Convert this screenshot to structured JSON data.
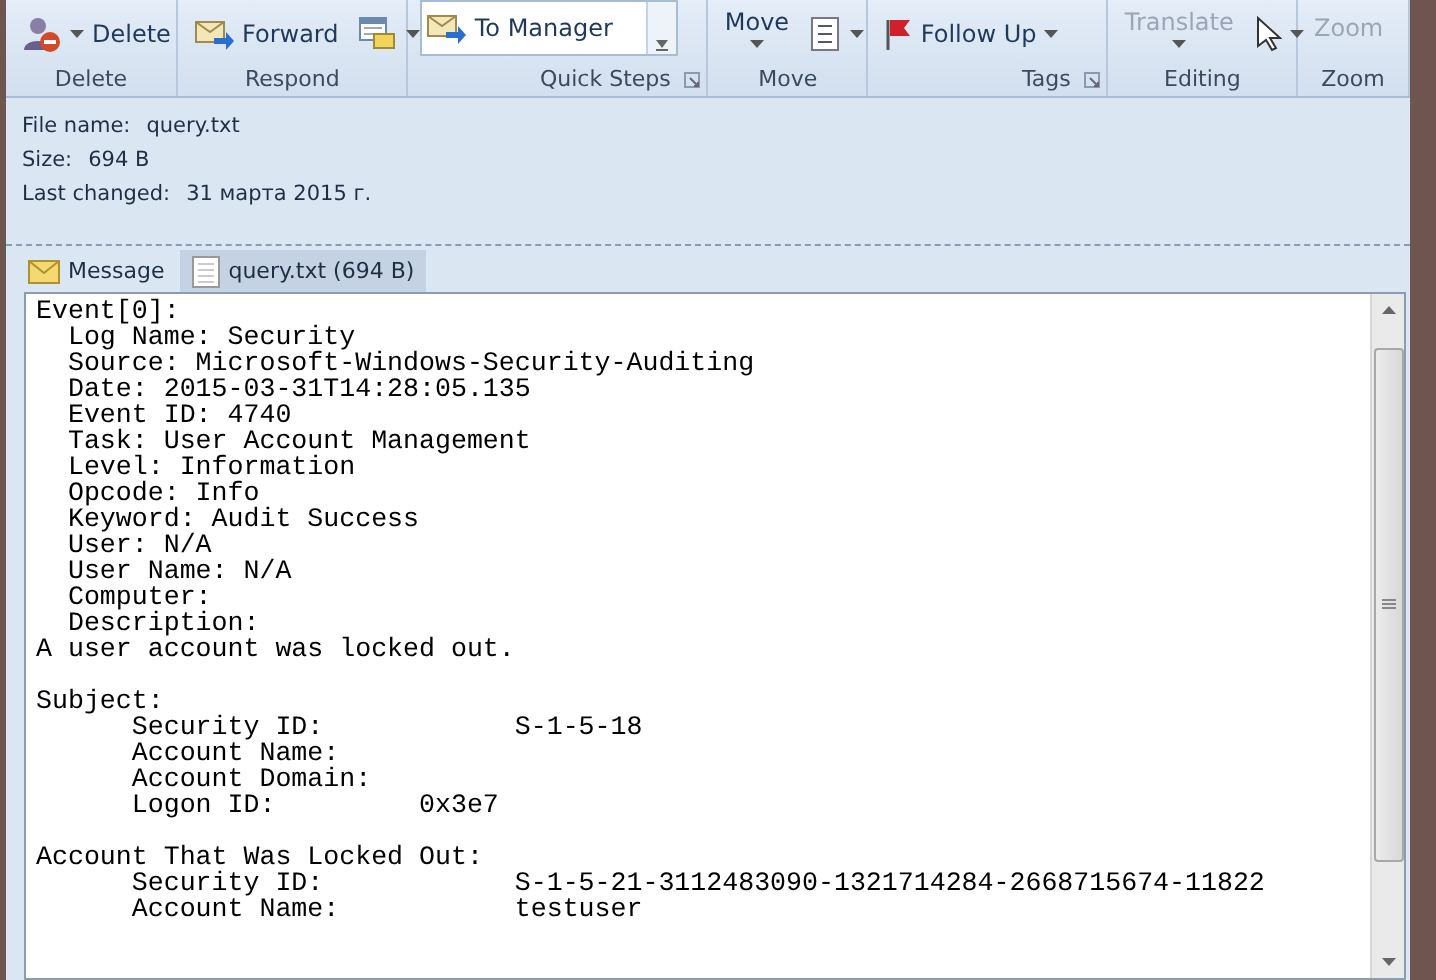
{
  "ribbon": {
    "groups": [
      {
        "label": "Delete",
        "items": [
          {
            "kind": "big",
            "label": "Delete",
            "caret": true
          }
        ]
      },
      {
        "label": "Respond",
        "items": [
          {
            "kind": "small",
            "label": "Forward",
            "caret": false
          },
          {
            "kind": "iconbtn",
            "caret": true
          }
        ]
      },
      {
        "label": "Quick Steps",
        "launcher": true,
        "items": [
          {
            "kind": "quickstep",
            "label": "To Manager"
          }
        ]
      },
      {
        "label": "Move",
        "items": [
          {
            "kind": "tall",
            "label": "Move",
            "caret": true,
            "disabled": false
          },
          {
            "kind": "iconbtn",
            "caret": true
          }
        ]
      },
      {
        "label": "Tags",
        "launcher": true,
        "items": [
          {
            "kind": "small",
            "label": "Follow Up",
            "caret": true
          }
        ]
      },
      {
        "label": "Editing",
        "items": [
          {
            "kind": "tall",
            "label": "Translate",
            "caret": true,
            "disabled": true
          },
          {
            "kind": "iconbtn",
            "caret": true
          }
        ]
      },
      {
        "label": "Zoom",
        "items": [
          {
            "kind": "tall",
            "label": "Zoom",
            "caret": false,
            "disabled": true
          }
        ]
      }
    ]
  },
  "attachment": {
    "fields": [
      {
        "label": "File name:",
        "value": "query.txt"
      },
      {
        "label": "Size:",
        "value": "694 B"
      },
      {
        "label": "Last changed:",
        "value": "31 марта 2015 г."
      }
    ]
  },
  "tabs": [
    {
      "label": "Message",
      "selected": false
    },
    {
      "label": "query.txt (694 B)",
      "selected": true
    }
  ],
  "preview": {
    "blocks": [
      [
        "Event[0]:",
        "  Log Name: Security",
        "  Source: Microsoft-Windows-Security-Auditing",
        "  Date: 2015-03-31T14:28:05.135",
        "  Event ID: 4740",
        "  Task: User Account Management",
        "  Level: Information",
        "  Opcode: Info",
        "  Keyword: Audit Success",
        "  User: N/A",
        "  User Name: N/A",
        "  Computer:",
        "  Description:",
        "A user account was locked out."
      ],
      [
        "Subject:",
        "      Security ID:            S-1-5-18",
        "      Account Name:",
        "      Account Domain:",
        "      Logon ID:         0x3e7"
      ],
      [
        "Account That Was Locked Out:",
        "      Security ID:            S-1-5-21-3112483090-1321714284-2668715674-11822",
        "      Account Name:           testuser"
      ]
    ]
  }
}
